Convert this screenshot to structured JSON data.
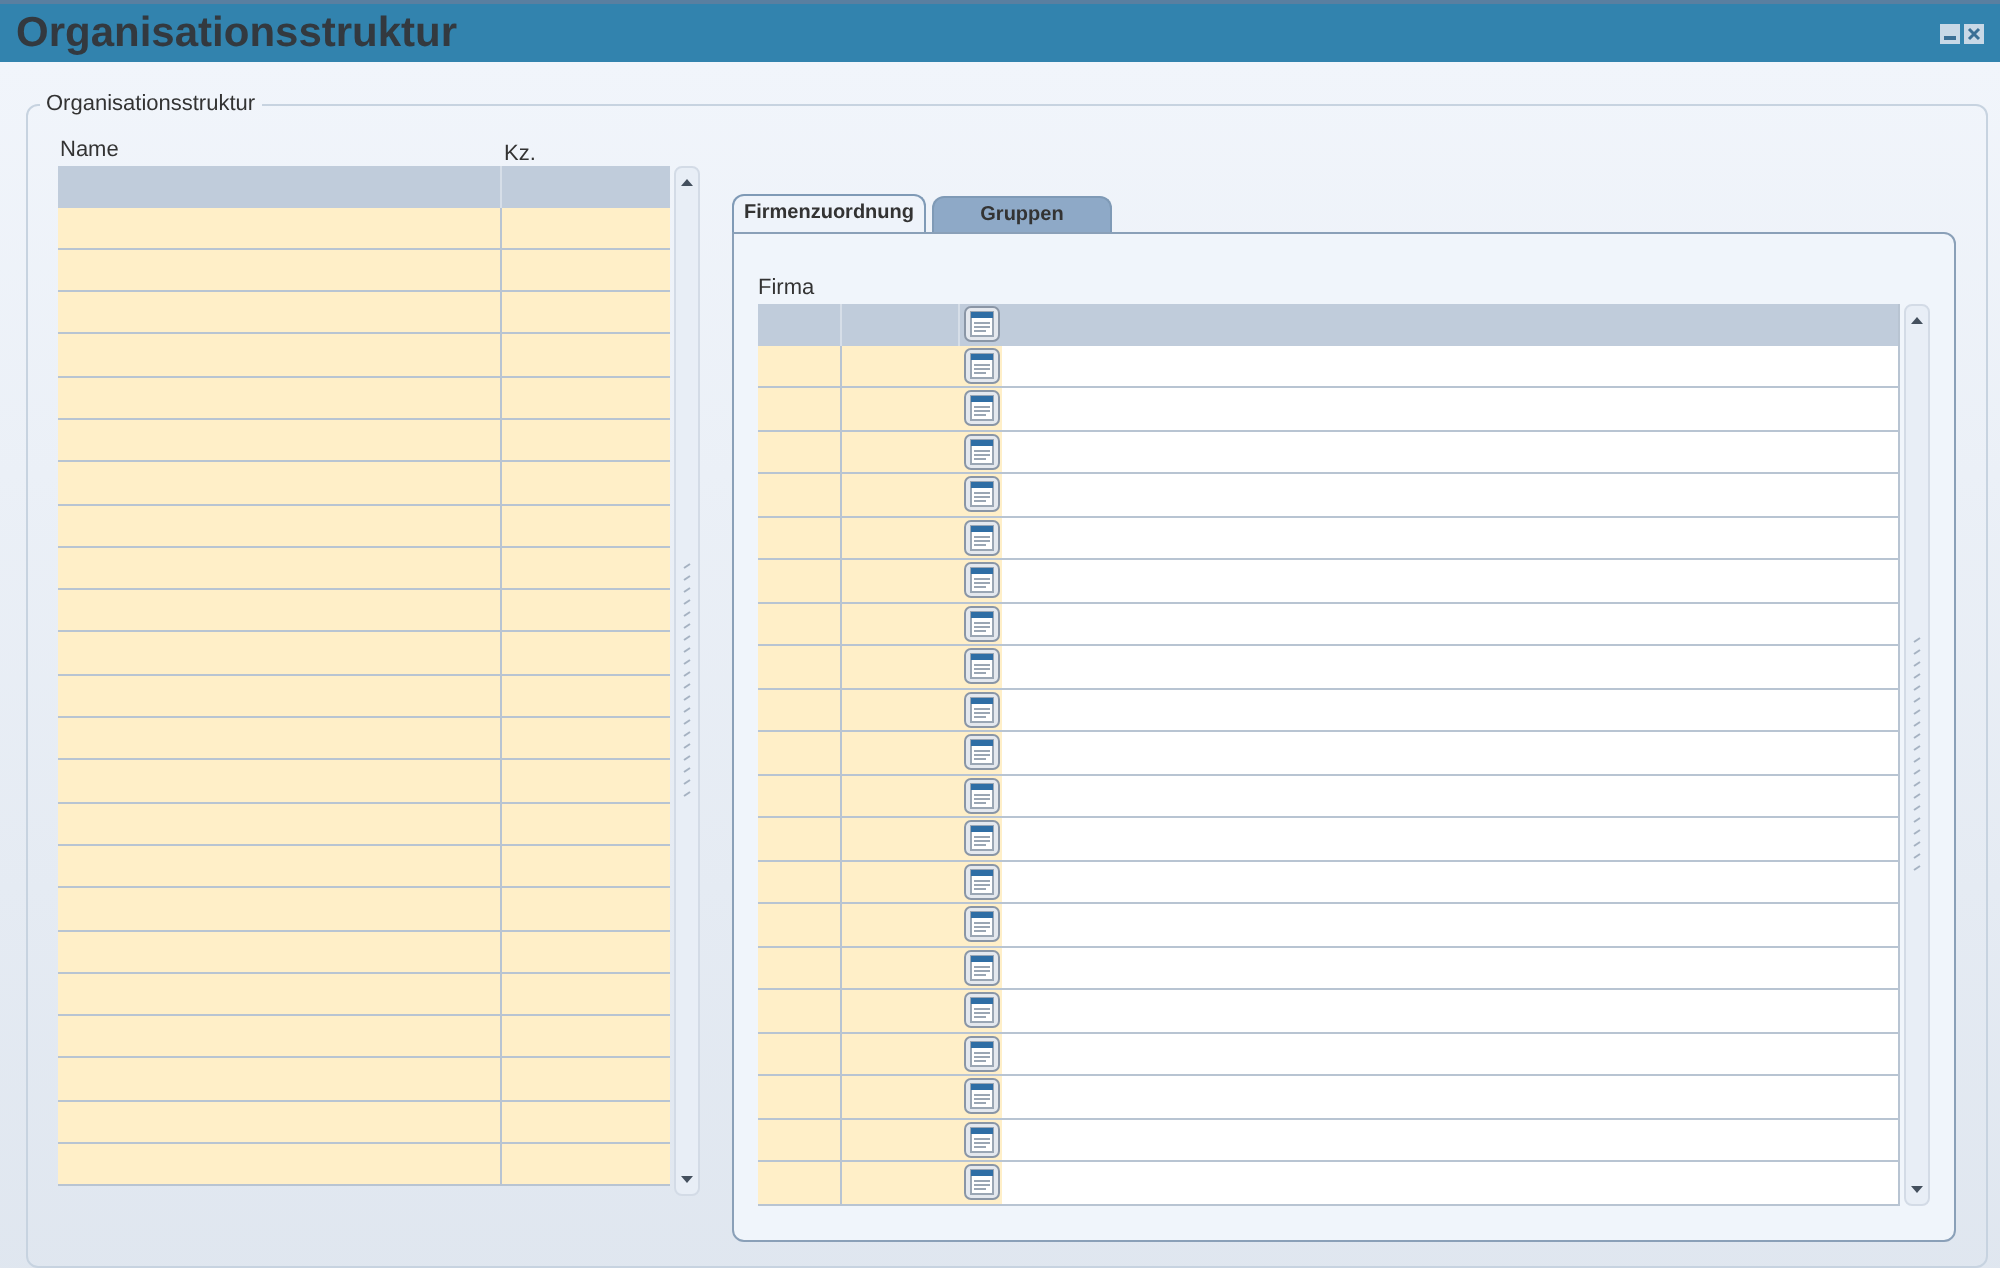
{
  "window": {
    "title": "Organisationsstruktur"
  },
  "group": {
    "legend": "Organisationsstruktur"
  },
  "left_table": {
    "columns": [
      "Name",
      "Kz."
    ]
  },
  "tabs": [
    {
      "label": "Firmenzuordnung",
      "selected": true
    },
    {
      "label": "Gruppen",
      "selected": false
    }
  ],
  "firma_table": {
    "label": "Firma"
  }
}
